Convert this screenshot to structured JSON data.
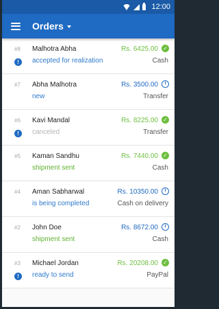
{
  "status_bar": {
    "time": "12:00"
  },
  "app_bar": {
    "title": "Orders"
  },
  "colors": {
    "blue_status": "#2e79cb",
    "green_status": "#5fb02f",
    "gray_status": "#b4b4b4",
    "green_amount": "#6dbf3f",
    "blue_amount": "#1f6ac2"
  },
  "orders": [
    {
      "number": "#8",
      "name": "Malhotra Abha",
      "status": "accepted for realization",
      "status_color": "#2e79cb",
      "amount": "Rs. 6425.00",
      "amount_color": "#6dbf3f",
      "state_icon": "check-circle-icon",
      "payment": "Cash",
      "alert": true
    },
    {
      "number": "#7",
      "name": "Abha Malhotra",
      "status": "new",
      "status_color": "#2e79cb",
      "amount": "Rs. 3500.00",
      "amount_color": "#1f6ac2",
      "state_icon": "info-circle-icon",
      "payment": "Transfer",
      "alert": false
    },
    {
      "number": "#6",
      "name": "Kavi Mandal",
      "status": "canceled",
      "status_color": "#b4b4b4",
      "amount": "Rs. 8225.00",
      "amount_color": "#6dbf3f",
      "state_icon": "check-circle-icon",
      "payment": "Transfer",
      "alert": true
    },
    {
      "number": "#5",
      "name": "Kaman Sandhu",
      "status": "shipment sent",
      "status_color": "#5fb02f",
      "amount": "Rs. 7440.00",
      "amount_color": "#6dbf3f",
      "state_icon": "check-circle-icon",
      "payment": "Cash",
      "alert": false
    },
    {
      "number": "#4",
      "name": "Aman Sabharwal",
      "status": "is being completed",
      "status_color": "#2e79cb",
      "amount": "Rs. 10350.00",
      "amount_color": "#1f6ac2",
      "state_icon": "info-circle-icon",
      "payment": "Cash on delivery",
      "alert": false
    },
    {
      "number": "#2",
      "name": "John Doe",
      "status": "shipment sent",
      "status_color": "#5fb02f",
      "amount": "Rs. 8672.00",
      "amount_color": "#1f6ac2",
      "state_icon": "info-circle-icon",
      "payment": "Cash",
      "alert": false
    },
    {
      "number": "#3",
      "name": "Michael Jordan",
      "status": "ready to send",
      "status_color": "#2e79cb",
      "amount": "Rs. 20208.00",
      "amount_color": "#6dbf3f",
      "state_icon": "check-circle-icon",
      "payment": "PayPal",
      "alert": true
    }
  ]
}
